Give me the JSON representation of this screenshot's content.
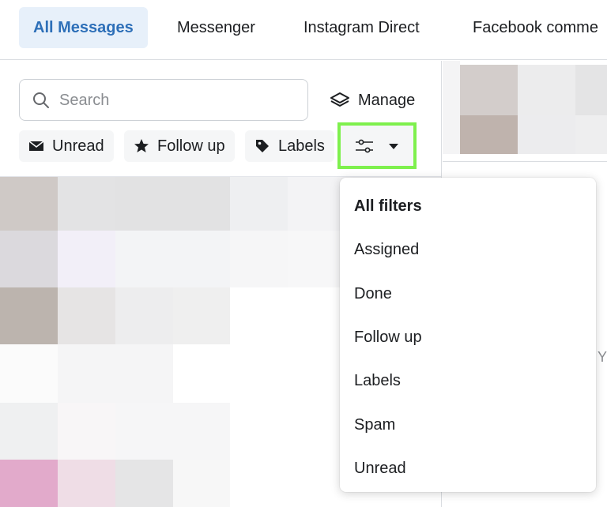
{
  "tabs": [
    {
      "label": "All Messages",
      "active": true
    },
    {
      "label": "Messenger",
      "active": false
    },
    {
      "label": "Instagram Direct",
      "active": false
    },
    {
      "label": "Facebook comme",
      "active": false
    }
  ],
  "search": {
    "placeholder": "Search",
    "icon": "search-icon"
  },
  "manage": {
    "label": "Manage",
    "icon": "layers-icon"
  },
  "filters": {
    "chips": [
      {
        "label": "Unread",
        "icon": "envelope-icon"
      },
      {
        "label": "Follow up",
        "icon": "star-icon"
      },
      {
        "label": "Labels",
        "icon": "tag-icon"
      }
    ],
    "filter_button": {
      "icon": "sliders-icon",
      "caret": "caret-down-icon",
      "highlight_color": "#7ef04d"
    }
  },
  "dropdown": {
    "items": [
      "All filters",
      "Assigned",
      "Done",
      "Follow up",
      "Labels",
      "Spam",
      "Unread"
    ]
  },
  "right_pane": {
    "hint_text": "Y"
  },
  "colors": {
    "accent": "#2d6fb8",
    "active_tab_bg": "#e7f0fa",
    "highlight": "#7ef04d"
  }
}
